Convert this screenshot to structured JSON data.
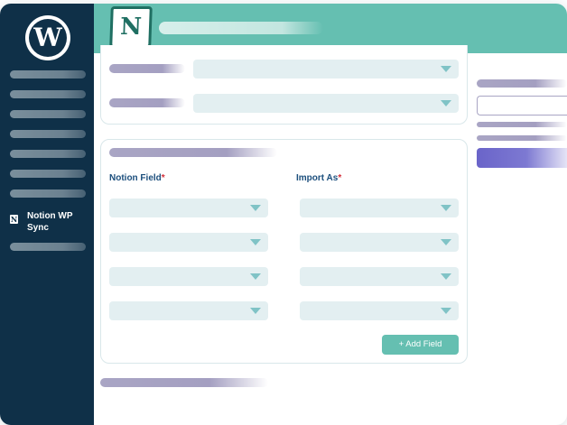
{
  "sidebar": {
    "logo_icon": "wordpress-logo",
    "logo_glyph": "W",
    "active_item": {
      "icon": "notion-icon",
      "icon_glyph": "N",
      "label": "Notion WP Sync"
    }
  },
  "header": {
    "logo_icon": "notion-logo",
    "logo_glyph": "N"
  },
  "mapping": {
    "notion_field_label": "Notion Field",
    "import_as_label": "Import As",
    "required_marker": "*",
    "add_field_button": "+ Add Field",
    "row_count": 4
  },
  "colors": {
    "sidebar": "#0f3048",
    "header": "#65bfb1",
    "accent": "#65bfb1",
    "primary_button": "#6a64c9",
    "label_text": "#1c4f7d",
    "required": "#d32f3a"
  }
}
